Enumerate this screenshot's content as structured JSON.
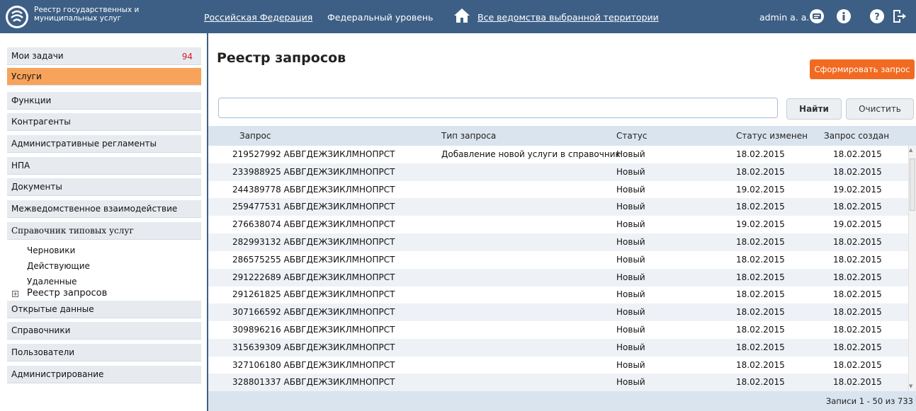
{
  "header": {
    "logo_text": "Реестр государственных и муниципальных услуг",
    "links": [
      "Российская Федерация",
      "Федеральный уровень",
      "Все ведомства выбранной территории"
    ],
    "user": "admin a. a.",
    "icons": [
      "chat-icon",
      "info-icon",
      "help-icon",
      "logout-icon"
    ]
  },
  "sidebar": {
    "items": [
      {
        "label": "Мои задачи",
        "count": "94"
      },
      {
        "label": "Услуги"
      },
      {
        "label": "Функции"
      },
      {
        "label": "Контрагенты"
      },
      {
        "label": "Административные регламенты"
      },
      {
        "label": "НПА"
      },
      {
        "label": "Документы"
      },
      {
        "label": "Межведомственное взаимодействие"
      },
      {
        "label": "Справочник типовых услуг"
      }
    ],
    "sub_items": [
      "Черновики",
      "Действующие",
      "Удаленные"
    ],
    "tree_root": "Реестр запросов",
    "items_after": [
      "Открытые данные",
      "Справочники",
      "Пользователи",
      "Администрирование"
    ]
  },
  "main": {
    "title": "Реестр запросов",
    "create_button": "Сформировать запрос",
    "search": {
      "value": "",
      "placeholder": ""
    },
    "find_button": "Найти",
    "clear_button": "Очистить",
    "columns": [
      "Запрос",
      "Тип запроса",
      "Статус",
      "Статус изменен",
      "Запрос создан"
    ],
    "rows": [
      {
        "request": "219527992 АБВГДЕЖЗИКЛМНОПРСТ",
        "type": "Добавление новой услуги в справочник",
        "status": "Новый",
        "changed": "18.02.2015",
        "created": "18.02.2015"
      },
      {
        "request": "233988925 АБВГДЕЖЗИКЛМНОПРСТ",
        "type": "",
        "status": "Новый",
        "changed": "18.02.2015",
        "created": "18.02.2015"
      },
      {
        "request": "244389778 АБВГДЕЖЗИКЛМНОПРСТ",
        "type": "",
        "status": "Новый",
        "changed": "19.02.2015",
        "created": "19.02.2015"
      },
      {
        "request": "259477531 АБВГДЕЖЗИКЛМНОПРСТ",
        "type": "",
        "status": "Новый",
        "changed": "18.02.2015",
        "created": "18.02.2015"
      },
      {
        "request": "276638074 АБВГДЕЖЗИКЛМНОПРСТ",
        "type": "",
        "status": "Новый",
        "changed": "19.02.2015",
        "created": "19.02.2015"
      },
      {
        "request": "282993132 АБВГДЕЖЗИКЛМНОПРСТ",
        "type": "",
        "status": "Новый",
        "changed": "18.02.2015",
        "created": "18.02.2015"
      },
      {
        "request": "286575255 АБВГДЕЖЗИКЛМНОПРСТ",
        "type": "",
        "status": "Новый",
        "changed": "18.02.2015",
        "created": "18.02.2015"
      },
      {
        "request": "291222689 АБВГДЕЖЗИКЛМНОПРСТ",
        "type": "",
        "status": "Новый",
        "changed": "18.02.2015",
        "created": "18.02.2015"
      },
      {
        "request": "291261825 АБВГДЕЖЗИКЛМНОПРСТ",
        "type": "",
        "status": "Новый",
        "changed": "18.02.2015",
        "created": "18.02.2015"
      },
      {
        "request": "307166592 АБВГДЕЖЗИКЛМНОПРСТ",
        "type": "",
        "status": "Новый",
        "changed": "18.02.2015",
        "created": "18.02.2015"
      },
      {
        "request": "309896216 АБВГДЕЖЗИКЛМНОПРСТ",
        "type": "",
        "status": "Новый",
        "changed": "18.02.2015",
        "created": "18.02.2015"
      },
      {
        "request": "315639309 АБВГДЕЖЗИКЛМНОПРСТ",
        "type": "",
        "status": "Новый",
        "changed": "18.02.2015",
        "created": "18.02.2015"
      },
      {
        "request": "327106180 АБВГДЕЖЗИКЛМНОПРСТ",
        "type": "",
        "status": "Новый",
        "changed": "18.02.2015",
        "created": "18.02.2015"
      },
      {
        "request": "328801337 АБВГДЕЖЗИКЛМНОПРСТ",
        "type": "",
        "status": "Новый",
        "changed": "18.02.2015",
        "created": "18.02.2015"
      }
    ],
    "records_text": "Записи 1 - 50 из 733"
  },
  "colors": {
    "header_bg": "#3d5f85",
    "active_item": "#f7a35b",
    "primary_button": "#f26a21",
    "count": "#d0202a"
  }
}
